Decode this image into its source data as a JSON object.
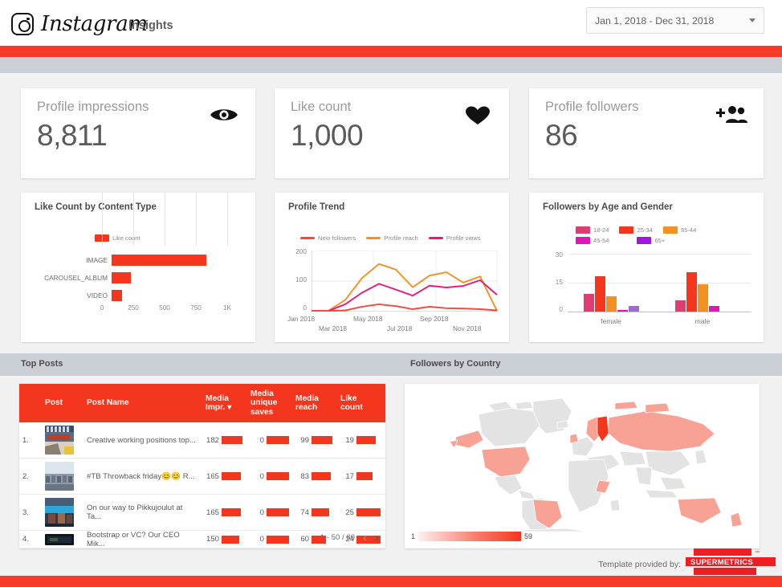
{
  "header": {
    "brand": "Instagram",
    "section": "Insights",
    "date_range": "Jan 1, 2018 - Dec 31, 2018",
    "brand_icon": "instagram-camera-icon",
    "caret_icon": "chevron-down-icon"
  },
  "scorecards": [
    {
      "title": "Profile impressions",
      "value": "8,811",
      "icon": "eye-icon"
    },
    {
      "title": "Like count",
      "value": "1,000",
      "icon": "heart-icon"
    },
    {
      "title": "Profile followers",
      "value": "86",
      "icon": "add-people-icon"
    }
  ],
  "sections": {
    "top_posts_label": "Top Posts",
    "followers_by_country_label": "Followers by Country"
  },
  "table": {
    "columns": [
      "",
      "Post",
      "Post Name",
      "Media Impr.",
      "Media unique saves",
      "Media reach",
      "Like count"
    ],
    "sort_column": "Media Impr.",
    "sort_icon": "sort-desc-icon",
    "rows": [
      {
        "rank": "1.",
        "name": "Creative working positions top...",
        "media_impr": "182",
        "media_saves": "0",
        "media_reach": "99",
        "like_count": "19"
      },
      {
        "rank": "2.",
        "name": "#TB Throwback friday😊😊 R...",
        "media_impr": "165",
        "media_saves": "0",
        "media_reach": "83",
        "like_count": "17"
      },
      {
        "rank": "3.",
        "name": "On our way to Pikkujoulut at Ta...",
        "media_impr": "165",
        "media_saves": "0",
        "media_reach": "74",
        "like_count": "25"
      },
      {
        "rank": "4.",
        "name": "Bootstrap or VC? Our CEO Mik...",
        "media_impr": "150",
        "media_saves": "0",
        "media_reach": "60",
        "like_count": "24"
      }
    ],
    "pagination": "1 - 50 / 60",
    "prev_icon": "chevron-left-icon",
    "next_icon": "chevron-right-icon"
  },
  "footer": {
    "note": "Template provided by:",
    "logo_text": "SUPERMETRICS",
    "logo_tm": "™"
  },
  "colors": {
    "brand_red": "#f83a29",
    "bar_red": "#f4361e",
    "band_gray": "#cbd0d7",
    "page_bg": "#f1f1f1",
    "age_18_24": "#e03c72",
    "age_25_34": "#f4361e",
    "age_35_44": "#f59121",
    "age_45_54": "#e016b8",
    "age_65_plus": "#9e18e0",
    "new_followers": "#f4493a",
    "profile_reach": "#f59121",
    "profile_views": "#e8187a"
  },
  "chart_data": [
    {
      "type": "bar",
      "orientation": "horizontal",
      "title": "Like Count by Content Type",
      "legend": [
        "Like count"
      ],
      "legend_position": "top",
      "categories": [
        "IMAGE",
        "CAROUSEL_ALBUM",
        "VIDEO"
      ],
      "values": [
        750,
        150,
        85
      ],
      "xlabel": "",
      "ylabel": "",
      "xlim": [
        0,
        1000
      ],
      "xticks": [
        0,
        250,
        500,
        750,
        1000
      ],
      "xticklabels": [
        "0",
        "250",
        "500",
        "750",
        "1K"
      ],
      "grid": true
    },
    {
      "type": "line",
      "title": "Profile Trend",
      "legend_position": "top",
      "x": [
        "Jan 2018",
        "Feb 2018",
        "Mar 2018",
        "Apr 2018",
        "May 2018",
        "Jun 2018",
        "Jul 2018",
        "Aug 2018",
        "Sep 2018",
        "Oct 2018",
        "Nov 2018",
        "Dec 2018"
      ],
      "xticklabels": [
        "Jan 2018",
        "Mar 2018",
        "May 2018",
        "Jul 2018",
        "Sep 2018",
        "Nov 2018"
      ],
      "ylim": [
        0,
        200
      ],
      "yticks": [
        0,
        100,
        200
      ],
      "grid": true,
      "series": [
        {
          "name": "New followers",
          "values": [
            2,
            2,
            4,
            16,
            24,
            18,
            8,
            16,
            11,
            10,
            8,
            4
          ]
        },
        {
          "name": "Profile reach",
          "values": [
            2,
            3,
            38,
            110,
            156,
            138,
            80,
            118,
            129,
            95,
            115,
            4
          ]
        },
        {
          "name": "Profile views",
          "values": [
            2,
            2,
            24,
            62,
            91,
            72,
            52,
            85,
            79,
            84,
            103,
            55
          ]
        }
      ]
    },
    {
      "type": "bar",
      "orientation": "vertical",
      "title": "Followers by Age and Gender",
      "legend": [
        "18-24",
        "25-34",
        "35-44",
        "45-54",
        "65+"
      ],
      "legend_position": "top",
      "categories": [
        "female",
        "male"
      ],
      "ylim": [
        0,
        30
      ],
      "yticks": [
        0,
        15,
        30
      ],
      "grid": true,
      "series": [
        {
          "name": "18-24",
          "values": [
            9,
            6
          ]
        },
        {
          "name": "25-34",
          "values": [
            18.5,
            20.5
          ]
        },
        {
          "name": "35-44",
          "values": [
            8,
            14
          ]
        },
        {
          "name": "45-54",
          "values": [
            0.6,
            3
          ]
        },
        {
          "name": "65+",
          "values": [
            3,
            0
          ]
        }
      ]
    },
    {
      "type": "heatmap",
      "subtype": "geo-choropleth",
      "title": "Followers by Country",
      "legend_min": "1",
      "legend_max": "59",
      "regions": [
        {
          "name": "Finland",
          "value": 59
        },
        {
          "name": "Russia",
          "value": 8
        },
        {
          "name": "United States",
          "value": 7
        },
        {
          "name": "Brazil",
          "value": 5
        },
        {
          "name": "Australia",
          "value": 4
        },
        {
          "name": "Sweden",
          "value": 6
        },
        {
          "name": "United Kingdom",
          "value": 4
        },
        {
          "name": "Norway",
          "value": 3
        },
        {
          "name": "New Zealand",
          "value": 3
        },
        {
          "name": "Nigeria",
          "value": 2
        }
      ]
    }
  ]
}
